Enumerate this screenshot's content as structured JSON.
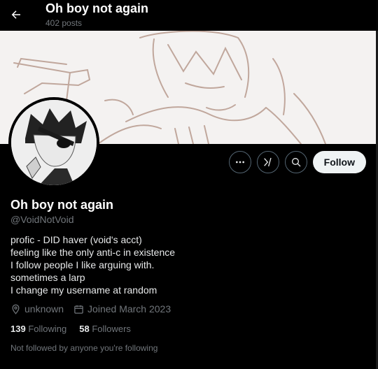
{
  "header": {
    "title": "Oh boy not again",
    "post_count": "402 posts"
  },
  "profile": {
    "display_name": "Oh boy not again",
    "handle": "@VoidNotVoid",
    "bio_lines": [
      "profic - DID haver (void's acct)",
      "feeling like the only anti-c in existence",
      "I follow people I like arguing with.",
      "sometimes a larp",
      "I change my username at random"
    ],
    "location": "unknown",
    "joined": "Joined March 2023",
    "following_count": "139",
    "following_label": "Following",
    "followers_count": "58",
    "followers_label": "Followers",
    "followed_note": "Not followed by anyone you're following"
  },
  "actions": {
    "follow_label": "Follow"
  },
  "colors": {
    "background": "#000000",
    "muted_text": "#71767b",
    "button_border": "#536471",
    "follow_bg": "#eff3f4",
    "banner_sketch": "#b89a8e"
  },
  "icons": [
    "back-arrow-icon",
    "more-icon",
    "grok-icon",
    "search-icon",
    "location-icon",
    "calendar-icon"
  ]
}
